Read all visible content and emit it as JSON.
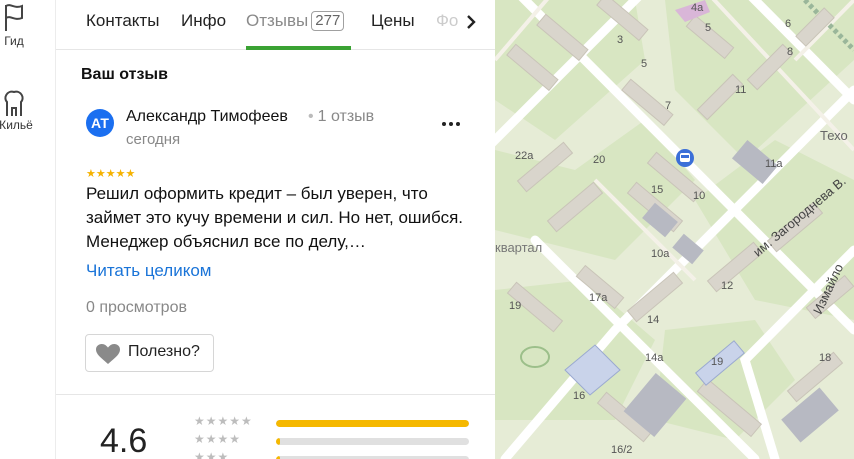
{
  "rail": {
    "items": [
      {
        "label": "Гид",
        "icon": "flag-icon"
      },
      {
        "label": "Жильё",
        "icon": "house-icon"
      }
    ]
  },
  "tabs": {
    "items": [
      {
        "label": "Контакты"
      },
      {
        "label": "Инфо"
      },
      {
        "label": "Отзывы",
        "count": "277",
        "active": true
      },
      {
        "label": "Цены"
      },
      {
        "label": "Фо"
      }
    ]
  },
  "review_section": {
    "title": "Ваш отзыв",
    "author": {
      "initials": "АТ",
      "name": "Александр Тимофеев",
      "reviews_count": "1 отзыв",
      "date": "сегодня",
      "avatar_color": "#1b6ff0"
    },
    "stars": "★★★★★",
    "rating": 5,
    "text": "Решил оформить кредит – был уверен, что займет это кучу времени и сил. Но нет, ошибся. Менеджер объяснил все по делу,…",
    "read_more": "Читать целиком",
    "views": "0 просмотров",
    "helpful_button": "Полезно?"
  },
  "summary": {
    "rating": "4.6",
    "distribution": [
      {
        "stars": "★★★★★",
        "fraction": 1.0
      },
      {
        "stars": "★★★★",
        "fraction": 0.02
      },
      {
        "stars": "★★★",
        "fraction": 0.02
      }
    ]
  },
  "map": {
    "street_labels": [
      "им. Загороднева В.",
      "Измайло"
    ],
    "district_label": "квартал",
    "poi_label": "Техо",
    "building_numbers": [
      "4а",
      "5",
      "3",
      "5",
      "7",
      "11",
      "8",
      "22а",
      "20",
      "15",
      "10",
      "11а",
      "10а",
      "19",
      "17а",
      "12",
      "14",
      "14а",
      "16",
      "19",
      "18",
      "16/2",
      "6"
    ],
    "transit_icon": "bus-stop-icon"
  },
  "colors": {
    "accent_green": "#3aa233",
    "link_blue": "#1a74d8",
    "star_yellow": "#f5b800"
  }
}
